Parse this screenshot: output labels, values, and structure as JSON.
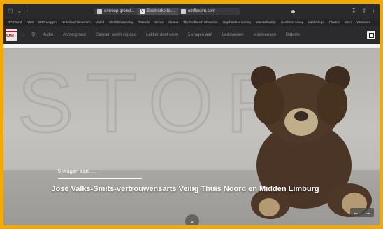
{
  "browser": {
    "tabs": [
      {
        "label": "omroep gronst..."
      },
      {
        "label": "Besmerke tel..."
      },
      {
        "label": "omflexpm.com"
      }
    ]
  },
  "bookmarks": [
    "NPO Sent",
    "NOS",
    "BNR Leggen",
    "Nederland Nieuwsen",
    "Vinted",
    "Met Blaspressing",
    "Trabtolo",
    "Sirene",
    "Spotus",
    "The Redbooth Showtime",
    "Hopthooterchecking",
    "Mamaahaaitije",
    "Kootkinet sonag",
    "Labberiege",
    "Plaates",
    "Meer",
    "Varstakes"
  ],
  "site": {
    "logo_text": "OM",
    "nav": [
      "Audio",
      "Achtergrond",
      "Camren werkt vaj deo",
      "Lekker doet weet",
      "5 vragen aan",
      "Leesvelden",
      "Minimensen",
      "Dateille"
    ]
  },
  "hero": {
    "wall_text": "STOP",
    "kicker": "5 vragen aan.....",
    "headline": "José Valks-Smits-vertrouwensarts Veilig Thuis Noord en Midden Limburg",
    "prev_icon": "arrow-left-icon",
    "next_icon": "arrow-right-icon",
    "scroll_icon": "chevron-down-icon"
  },
  "colors": {
    "frame": "#f5a800",
    "brand_red": "#c1121f"
  }
}
